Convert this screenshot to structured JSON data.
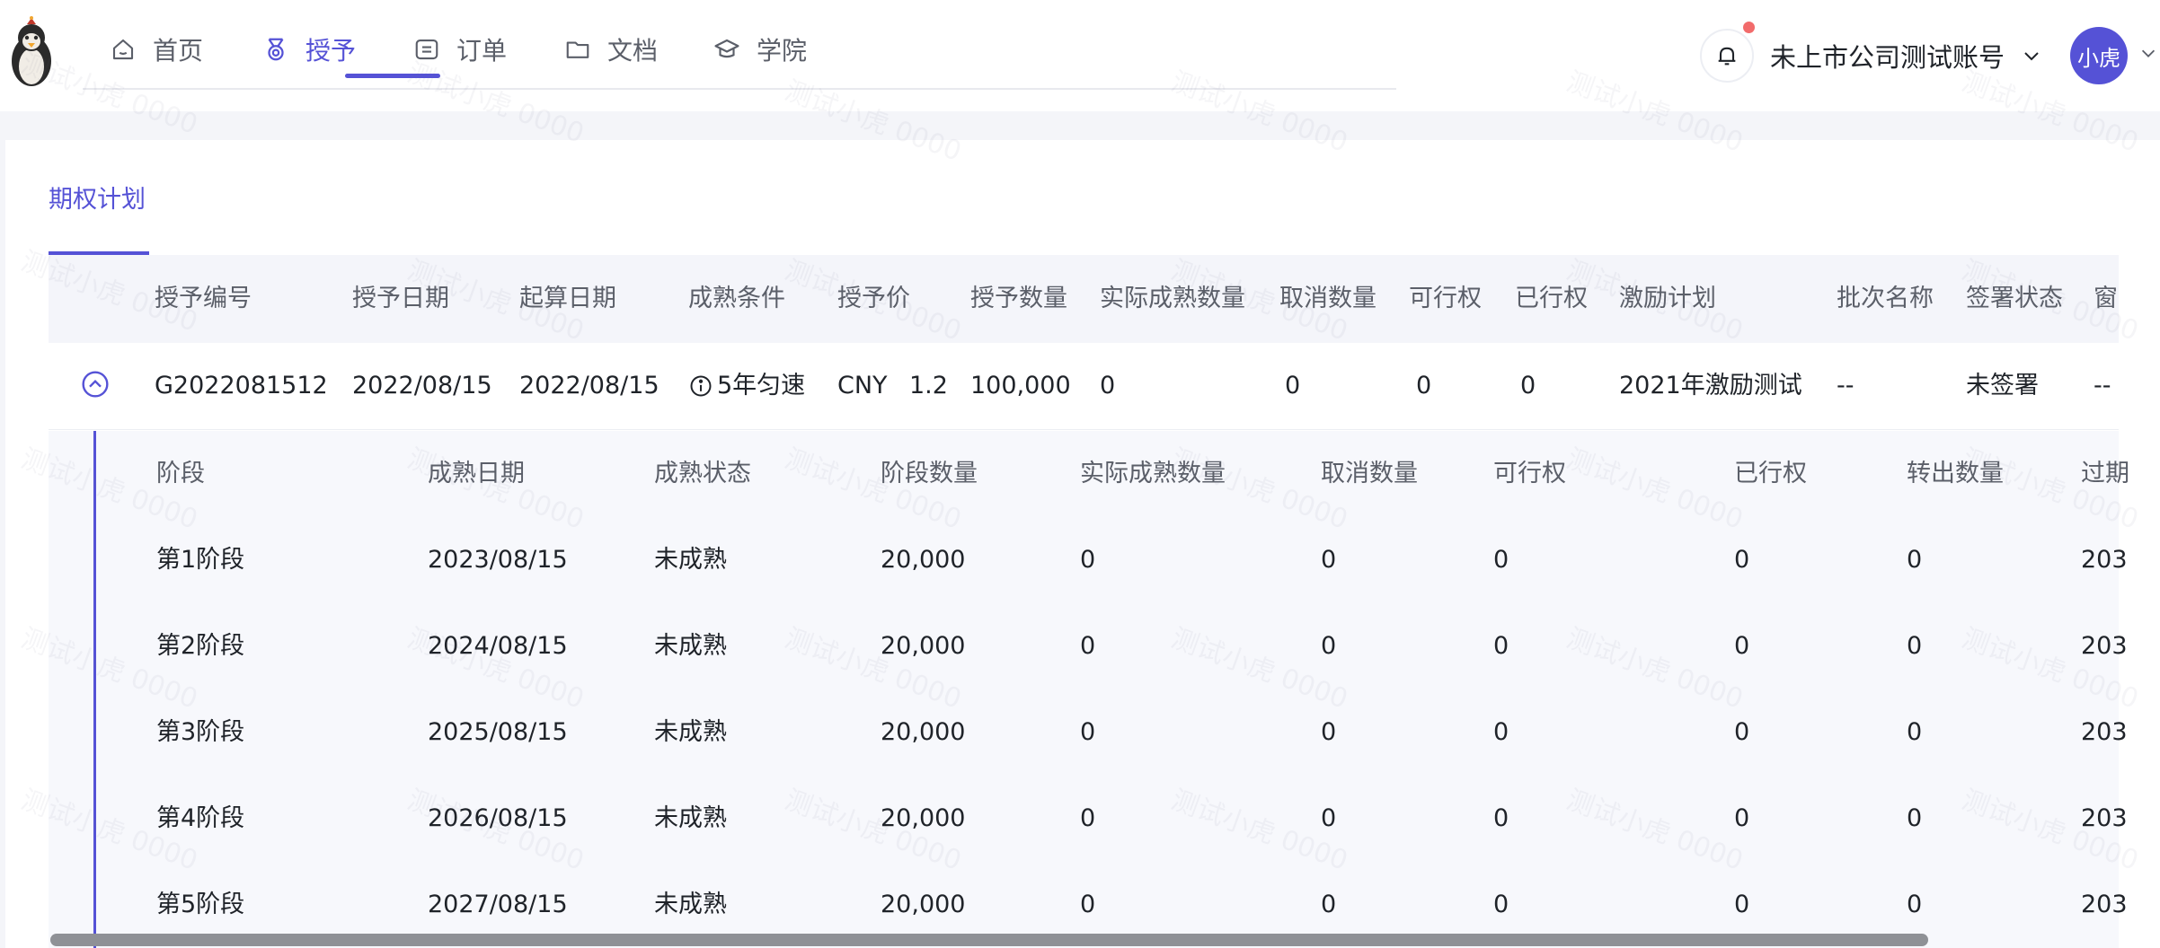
{
  "nav": {
    "items": [
      {
        "label": "首页",
        "icon": "home-icon"
      },
      {
        "label": "授予",
        "icon": "medal-icon"
      },
      {
        "label": "订单",
        "icon": "order-icon"
      },
      {
        "label": "文档",
        "icon": "folder-icon"
      },
      {
        "label": "学院",
        "icon": "academy-icon"
      }
    ],
    "active_index": 1
  },
  "header": {
    "account_name": "未上市公司测试账号",
    "avatar_text": "小虎"
  },
  "watermark": "测试小虎 0000",
  "tab": {
    "label": "期权计划"
  },
  "grants_table": {
    "columns": [
      "授予编号",
      "授予日期",
      "起算日期",
      "成熟条件",
      "授予价",
      "授予数量",
      "实际成熟数量",
      "取消数量",
      "可行权",
      "已行权",
      "激励计划",
      "批次名称",
      "签署状态",
      "窗"
    ],
    "row": {
      "grant_no": "G2022081512",
      "grant_date": "2022/08/15",
      "start_date": "2022/08/15",
      "vesting_condition": "5年匀速",
      "price_currency": "CNY",
      "price_value": "1.2",
      "quantity": "100,000",
      "vested": "0",
      "cancelled": "0",
      "exercisable": "0",
      "exercised": "0",
      "plan": "2021年激励测试",
      "batch": "--",
      "sign_status": "未签署",
      "window": "--"
    }
  },
  "stages_table": {
    "columns": [
      "阶段",
      "成熟日期",
      "成熟状态",
      "阶段数量",
      "实际成熟数量",
      "取消数量",
      "可行权",
      "已行权",
      "转出数量",
      "过期"
    ],
    "rows": [
      {
        "stage": "第1阶段",
        "date": "2023/08/15",
        "status": "未成熟",
        "qty": "20,000",
        "vested": "0",
        "cancelled": "0",
        "exercisable": "0",
        "exercised": "0",
        "transferred": "0",
        "expiry": "203"
      },
      {
        "stage": "第2阶段",
        "date": "2024/08/15",
        "status": "未成熟",
        "qty": "20,000",
        "vested": "0",
        "cancelled": "0",
        "exercisable": "0",
        "exercised": "0",
        "transferred": "0",
        "expiry": "203"
      },
      {
        "stage": "第3阶段",
        "date": "2025/08/15",
        "status": "未成熟",
        "qty": "20,000",
        "vested": "0",
        "cancelled": "0",
        "exercisable": "0",
        "exercised": "0",
        "transferred": "0",
        "expiry": "203"
      },
      {
        "stage": "第4阶段",
        "date": "2026/08/15",
        "status": "未成熟",
        "qty": "20,000",
        "vested": "0",
        "cancelled": "0",
        "exercisable": "0",
        "exercised": "0",
        "transferred": "0",
        "expiry": "203"
      },
      {
        "stage": "第5阶段",
        "date": "2027/08/15",
        "status": "未成熟",
        "qty": "20,000",
        "vested": "0",
        "cancelled": "0",
        "exercisable": "0",
        "exercised": "0",
        "transferred": "0",
        "expiry": "203"
      }
    ]
  },
  "colors": {
    "accent": "#5552d6",
    "notification_dot": "#f26b6b",
    "header_bg": "#f4f5fa",
    "nested_bg": "#f7f8fc"
  }
}
